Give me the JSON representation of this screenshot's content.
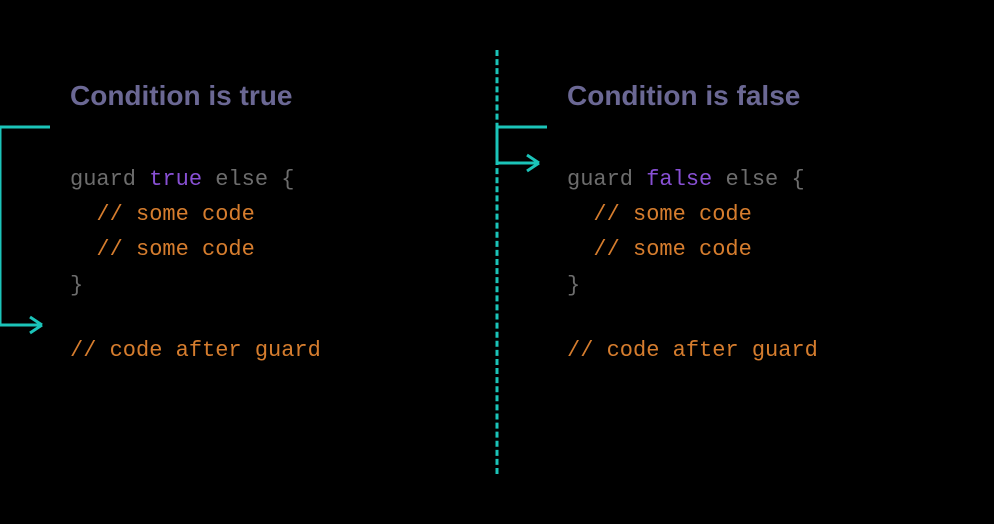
{
  "left": {
    "title": "Condition is true",
    "guard_kw": "guard",
    "condition": "true",
    "else_kw": "else",
    "brace_open": " {",
    "line1": "// some code",
    "line2": "// some code",
    "brace_close": "}",
    "after": "// code after guard"
  },
  "right": {
    "title": "Condition is false",
    "guard_kw": "guard",
    "condition": "false",
    "else_kw": "else",
    "brace_open": " {",
    "line1": "// some code",
    "line2": "// some code",
    "brace_close": "}",
    "after": "// code after guard"
  }
}
